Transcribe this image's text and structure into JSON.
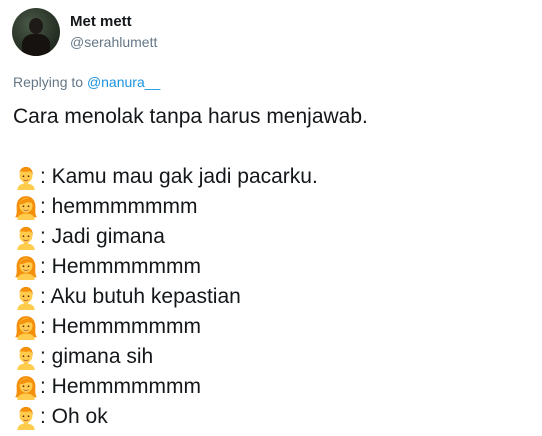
{
  "user": {
    "display_name": "Met mett",
    "handle": "@serahlumett"
  },
  "reply": {
    "prefix": "Replying to ",
    "mention": "@nanura__"
  },
  "tweet": {
    "headline": "Cara menolak tanpa harus menjawab.",
    "lines": [
      {
        "speaker": "man",
        "icon": "man-emoji-icon",
        "text": ": Kamu mau gak jadi pacarku."
      },
      {
        "speaker": "woman",
        "icon": "woman-emoji-icon",
        "text": ": hemmmmmmm"
      },
      {
        "speaker": "man",
        "icon": "man-emoji-icon",
        "text": ": Jadi gimana"
      },
      {
        "speaker": "woman",
        "icon": "woman-emoji-icon",
        "text": ": Hemmmmmmm"
      },
      {
        "speaker": "man",
        "icon": "man-emoji-icon",
        "text": ": Aku butuh kepastian"
      },
      {
        "speaker": "woman",
        "icon": "woman-emoji-icon",
        "text": ": Hemmmmmmm"
      },
      {
        "speaker": "man",
        "icon": "man-emoji-icon",
        "text": ": gimana sih"
      },
      {
        "speaker": "woman",
        "icon": "woman-emoji-icon",
        "text": ": Hemmmmmmm"
      },
      {
        "speaker": "man",
        "icon": "man-emoji-icon",
        "text": ": Oh ok"
      }
    ]
  },
  "colors": {
    "text": "#14171a",
    "secondary": "#657786",
    "link": "#1b95e0",
    "emoji_skin": "#ffcc4d",
    "emoji_hair": "#f4900c"
  }
}
